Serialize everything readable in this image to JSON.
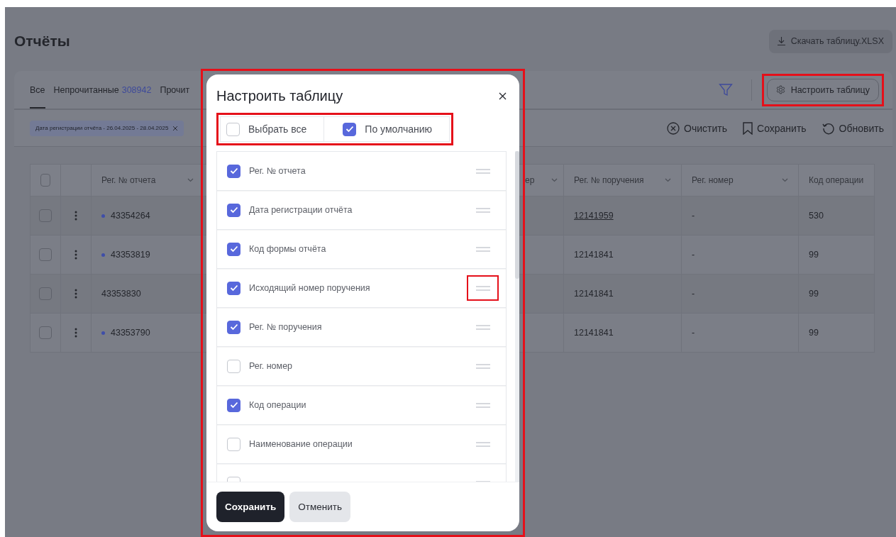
{
  "page": {
    "title": "Отчёты",
    "download_button": "Скачать таблицу.XLSX"
  },
  "tabs": [
    {
      "label": "Все",
      "selected": true
    },
    {
      "label": "Непрочитанные",
      "count": "308942",
      "selected": false
    },
    {
      "label": "Прочит",
      "selected": false
    }
  ],
  "configure_button": {
    "label": "Настроить таблицу",
    "highlighted": true
  },
  "filter_chips": [
    {
      "label": "Дата регистрации отчёта - 26.04.2025 - 28.04.2025"
    }
  ],
  "actions": [
    {
      "kind": "clear",
      "label": "Очистить"
    },
    {
      "kind": "save",
      "label": "Сохранить"
    },
    {
      "kind": "refresh",
      "label": "Обновить"
    }
  ],
  "table": {
    "all_checked": false,
    "columns": [
      {
        "label": "Рег. № отчета",
        "sort_icon": true
      },
      {
        "label": "ер",
        "sort_icon": true
      },
      {
        "label": "Рег. № поручения",
        "sort_icon": true
      },
      {
        "label": "Рег. номер",
        "sort_icon": true
      },
      {
        "label": "Код операции"
      }
    ],
    "rows": [
      {
        "checked": false,
        "unread": true,
        "report_no": "43354264",
        "order_no": "12141959",
        "order_link": true,
        "reg_no": "-",
        "op_code": "530"
      },
      {
        "checked": false,
        "unread": true,
        "report_no": "43353819",
        "order_no": "12141841",
        "order_link": false,
        "reg_no": "-",
        "op_code": "99"
      },
      {
        "checked": false,
        "unread": false,
        "report_no": "43353830",
        "order_no": "12141841",
        "order_link": false,
        "reg_no": "-",
        "op_code": "99"
      },
      {
        "checked": false,
        "unread": true,
        "report_no": "43353790",
        "order_no": "12141841",
        "order_link": false,
        "reg_no": "-",
        "op_code": "99"
      }
    ]
  },
  "modal": {
    "title": "Настроить таблицу",
    "highlighted": true,
    "toolbar": {
      "highlighted": true,
      "options": [
        {
          "label": "Выбрать все",
          "checked": false
        },
        {
          "label": "По умолчанию",
          "checked": true
        }
      ]
    },
    "items": [
      {
        "label": "Рег. № отчета",
        "checked": true,
        "handle_highlighted": false
      },
      {
        "label": "Дата регистрации отчёта",
        "checked": true,
        "handle_highlighted": false
      },
      {
        "label": "Код формы отчёта",
        "checked": true,
        "handle_highlighted": false
      },
      {
        "label": "Исходящий номер поручения",
        "checked": true,
        "handle_highlighted": true
      },
      {
        "label": "Рег. № поручения",
        "checked": true,
        "handle_highlighted": false
      },
      {
        "label": "Рег. номер",
        "checked": false,
        "handle_highlighted": false
      },
      {
        "label": "Код операции",
        "checked": true,
        "handle_highlighted": false
      },
      {
        "label": "Наименование операции",
        "checked": false,
        "handle_highlighted": false
      },
      {
        "checked": false,
        "handle_highlighted": false
      }
    ],
    "buttons": [
      {
        "kind": "primary",
        "label": "Сохранить"
      },
      {
        "kind": "secondary",
        "label": "Отменить"
      }
    ]
  }
}
